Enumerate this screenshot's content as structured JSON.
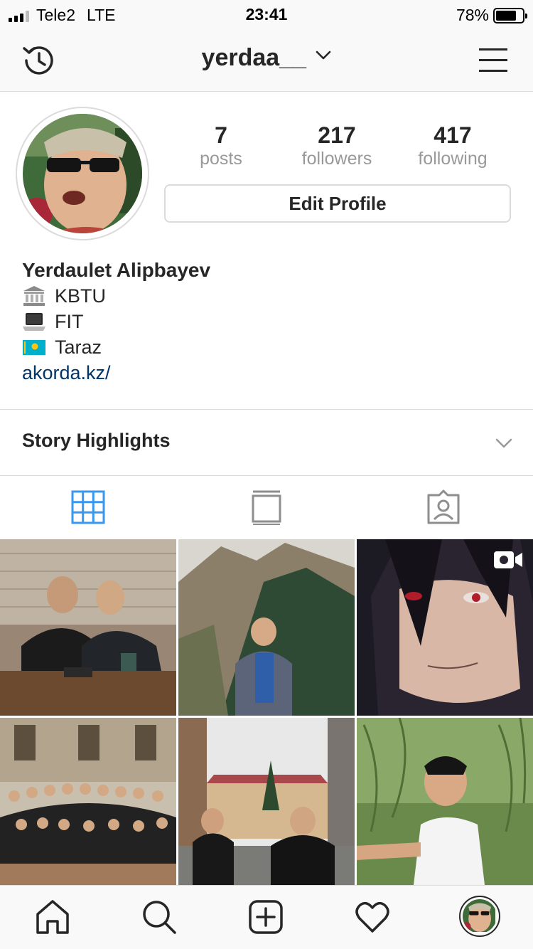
{
  "status_bar": {
    "carrier": "Tele2",
    "network": "LTE",
    "time": "23:41",
    "battery": "78%",
    "battery_level": 0.78
  },
  "nav": {
    "username": "yerdaa__"
  },
  "profile": {
    "stats": [
      {
        "value": "7",
        "label": "posts"
      },
      {
        "value": "217",
        "label": "followers"
      },
      {
        "value": "417",
        "label": "following"
      }
    ],
    "edit_button": "Edit Profile",
    "full_name": "Yerdaulet Alipbayev",
    "bio_lines": [
      "KBTU",
      "FIT",
      "Taraz"
    ],
    "bio_icons": [
      "classical-building-emoji",
      "laptop-emoji",
      "kazakhstan-flag-emoji"
    ],
    "website": "akorda.kz/"
  },
  "highlights": {
    "label": "Story Highlights"
  },
  "tabs": [
    "grid-icon",
    "feed-icon",
    "tagged-icon"
  ],
  "active_tab": "grid-icon",
  "colors": {
    "accent": "#3897f0",
    "link": "#003569",
    "border": "#dbdbdb",
    "muted": "#999999",
    "text": "#262626"
  },
  "bottom_nav": [
    "home-icon",
    "search-icon",
    "new-post-icon",
    "activity-heart-icon",
    "profile-avatar"
  ]
}
